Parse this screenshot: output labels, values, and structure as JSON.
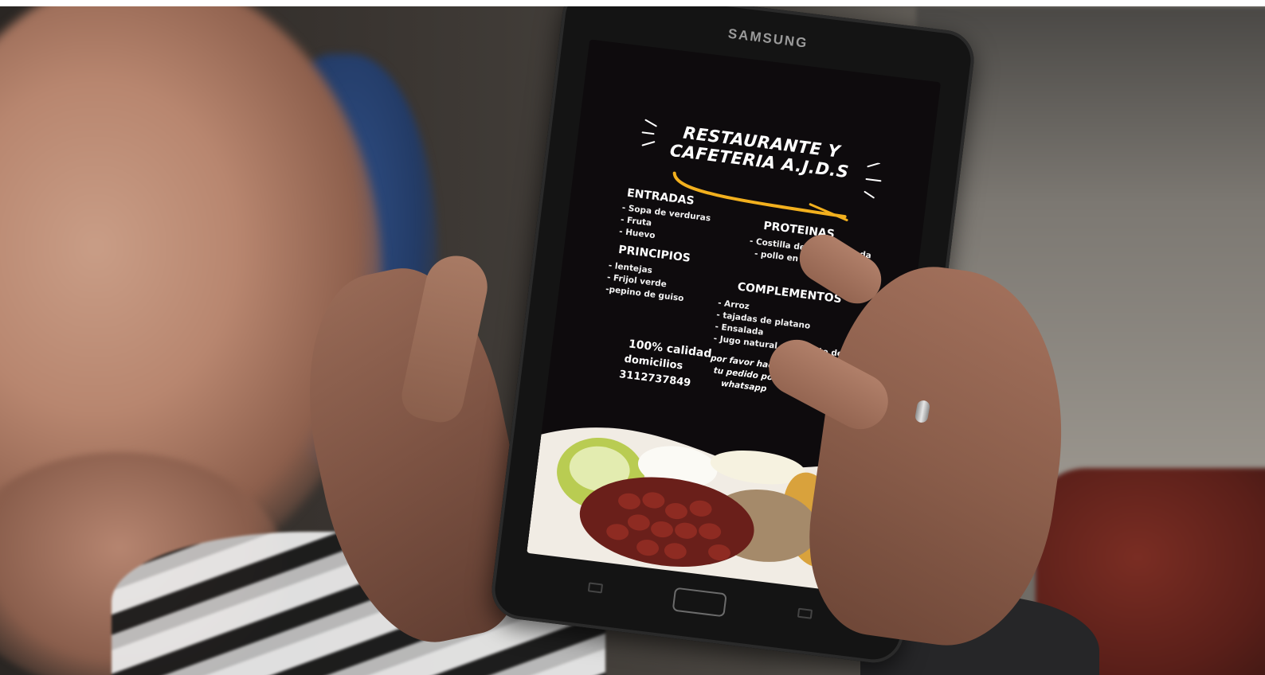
{
  "device": {
    "brand": "SAMSUNG"
  },
  "menu": {
    "title_line1": "RESTAURANTE Y",
    "title_line2": "CAFETERIA A.J.D.S",
    "sections": {
      "entradas": {
        "heading": "ENTRADAS",
        "items": [
          "- Sopa de verduras",
          "- Fruta",
          "- Huevo"
        ]
      },
      "proteinas": {
        "heading": "PROTEINAS",
        "items": [
          "- Costilla de cerdo sudada",
          "- pollo en salsa bbq"
        ]
      },
      "principios": {
        "heading": "PRINCIPIOS",
        "items": [
          "- lentejas",
          "- Frijol verde",
          "-pepino de guiso"
        ]
      },
      "complementos": {
        "heading": "COMPLEMENTOS",
        "items": [
          "- Arroz",
          "- tajadas de platano",
          "- Ensalada",
          "- Jugo natural de tomate de arbol"
        ]
      }
    },
    "quality": "100% calidad",
    "delivery": "domicilios",
    "phone": "3112737849",
    "order_note_line1": "por favor hacer",
    "order_note_line2": "tu pedido por",
    "order_note_line3": "whatsapp"
  },
  "colors": {
    "accent": "#f2b01e",
    "screen_bg": "#0e0b0d"
  }
}
